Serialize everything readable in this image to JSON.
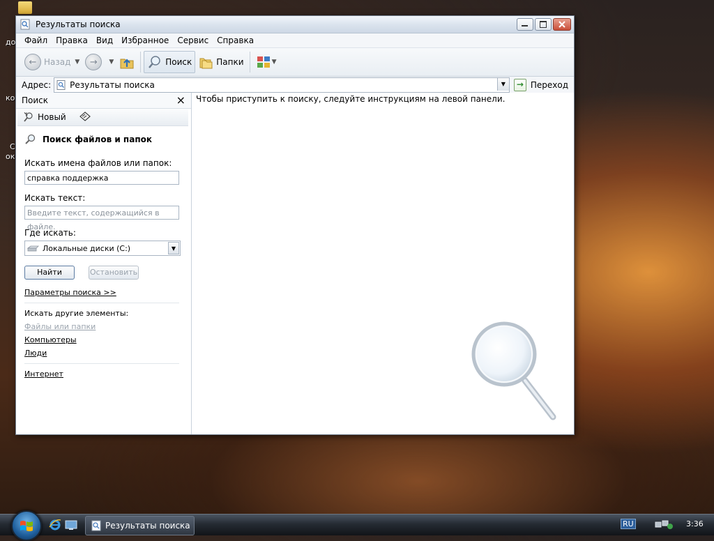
{
  "desktop": {
    "labels": [
      "до",
      "ко",
      "С",
      "ок"
    ]
  },
  "window": {
    "title": "Результаты поиска",
    "menu": [
      "Файл",
      "Правка",
      "Вид",
      "Избранное",
      "Сервис",
      "Справка"
    ],
    "toolbar": {
      "back_label": "Назад",
      "search_label": "Поиск",
      "folders_label": "Папки"
    },
    "address": {
      "label": "Адрес:",
      "value": "Результаты поиска",
      "go_label": "Переход"
    }
  },
  "search_pane": {
    "header": "Поиск",
    "close_glyph": "×",
    "new_label": "Новый",
    "section_title": "Поиск файлов и папок",
    "filename_label": "Искать имена файлов или папок:",
    "filename_value": "справка поддержка",
    "text_label": "Искать текст:",
    "text_placeholder": "Введите текст, содержащийся в файле.",
    "where_label": "Где искать:",
    "where_value": "Локальные диски (C:)",
    "find_button": "Найти",
    "stop_button": "Остановить",
    "options_link": "Параметры поиска >>",
    "other_label": "Искать другие элементы:",
    "other_items": {
      "files": "Файлы или папки",
      "computers": "Компьютеры",
      "people": "Люди",
      "internet": "Интернет"
    }
  },
  "results_pane": {
    "hint": "Чтобы приступить к поиску, следуйте инструкциям на левой панели."
  },
  "taskbar": {
    "task_label": "Результаты поиска",
    "lang": "RU",
    "clock": "3:36"
  }
}
